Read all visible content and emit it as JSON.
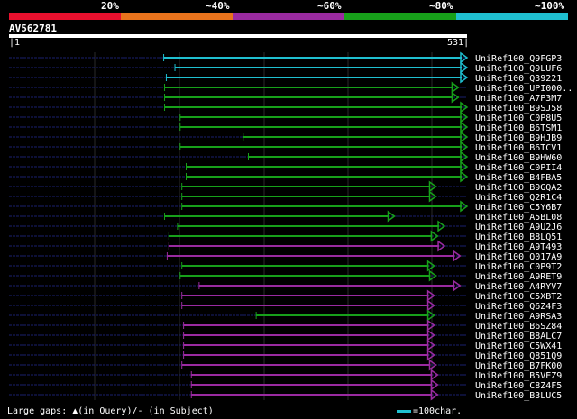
{
  "identity_legend": {
    "labels": [
      "20%",
      "~40%",
      "~60%",
      "~80%",
      "~100%"
    ],
    "colors": [
      "#e8102e",
      "#e8731c",
      "#9a2aa0",
      "#17a01a",
      "#1fbfd0"
    ]
  },
  "query": {
    "name": "AV562781",
    "start": "1",
    "end": "531",
    "length": 531
  },
  "hits": [
    {
      "name": "UniRef100_Q9FGP3",
      "start": 180,
      "end": 531,
      "identity": 100
    },
    {
      "name": "UniRef100_Q9LUF6",
      "start": 193,
      "end": 531,
      "identity": 100
    },
    {
      "name": "UniRef100_Q39221",
      "start": 183,
      "end": 531,
      "identity": 100
    },
    {
      "name": "UniRef100_UPI000..",
      "start": 181,
      "end": 521,
      "identity": 80
    },
    {
      "name": "UniRef100_A7P3M7",
      "start": 181,
      "end": 521,
      "identity": 80
    },
    {
      "name": "UniRef100_B9SJ58",
      "start": 181,
      "end": 531,
      "identity": 80
    },
    {
      "name": "UniRef100_C0P8U5",
      "start": 199,
      "end": 531,
      "identity": 80
    },
    {
      "name": "UniRef100_B6TSM1",
      "start": 199,
      "end": 531,
      "identity": 80
    },
    {
      "name": "UniRef100_B9HJB9",
      "start": 272,
      "end": 531,
      "identity": 80
    },
    {
      "name": "UniRef100_B6TCV1",
      "start": 199,
      "end": 531,
      "identity": 80
    },
    {
      "name": "UniRef100_B9HW60",
      "start": 278,
      "end": 531,
      "identity": 80
    },
    {
      "name": "UniRef100_C0PII4",
      "start": 206,
      "end": 531,
      "identity": 80
    },
    {
      "name": "UniRef100_B4FBA5",
      "start": 206,
      "end": 531,
      "identity": 80
    },
    {
      "name": "UniRef100_B9GQA2",
      "start": 201,
      "end": 495,
      "identity": 80
    },
    {
      "name": "UniRef100_Q2R1C4",
      "start": 201,
      "end": 495,
      "identity": 80
    },
    {
      "name": "UniRef100_C5Y6B7",
      "start": 201,
      "end": 531,
      "identity": 80
    },
    {
      "name": "UniRef100_A5BL08",
      "start": 181,
      "end": 447,
      "identity": 80
    },
    {
      "name": "UniRef100_A9U2J6",
      "start": 196,
      "end": 505,
      "identity": 80
    },
    {
      "name": "UniRef100_B8LQ51",
      "start": 186,
      "end": 497,
      "identity": 80
    },
    {
      "name": "UniRef100_A9T493",
      "start": 186,
      "end": 505,
      "identity": 60
    },
    {
      "name": "UniRef100_Q017A9",
      "start": 184,
      "end": 523,
      "identity": 60
    },
    {
      "name": "UniRef100_C0P9T2",
      "start": 201,
      "end": 493,
      "identity": 80
    },
    {
      "name": "UniRef100_A9RET9",
      "start": 199,
      "end": 495,
      "identity": 80
    },
    {
      "name": "UniRef100_A4RYV7",
      "start": 221,
      "end": 523,
      "identity": 60
    },
    {
      "name": "UniRef100_C5XBT2",
      "start": 201,
      "end": 493,
      "identity": 60
    },
    {
      "name": "UniRef100_Q6Z4F3",
      "start": 201,
      "end": 493,
      "identity": 60
    },
    {
      "name": "UniRef100_A9RSA3",
      "start": 287,
      "end": 493,
      "identity": 80
    },
    {
      "name": "UniRef100_B6SZ84",
      "start": 203,
      "end": 493,
      "identity": 60
    },
    {
      "name": "UniRef100_B8ALC7",
      "start": 203,
      "end": 493,
      "identity": 60
    },
    {
      "name": "UniRef100_C5WX41",
      "start": 203,
      "end": 493,
      "identity": 60
    },
    {
      "name": "UniRef100_Q851Q9",
      "start": 203,
      "end": 493,
      "identity": 60
    },
    {
      "name": "UniRef100_B7FK00",
      "start": 201,
      "end": 495,
      "identity": 60
    },
    {
      "name": "UniRef100_B5VEZ9",
      "start": 212,
      "end": 497,
      "identity": 60
    },
    {
      "name": "UniRef100_C8Z4F5",
      "start": 212,
      "end": 497,
      "identity": 60
    },
    {
      "name": "UniRef100_B3LUC5",
      "start": 212,
      "end": 497,
      "identity": 60
    }
  ],
  "footer": {
    "gaps_text": "Large gaps: ▲(in Query)/- (in Subject)",
    "scale_text": "=100char."
  }
}
